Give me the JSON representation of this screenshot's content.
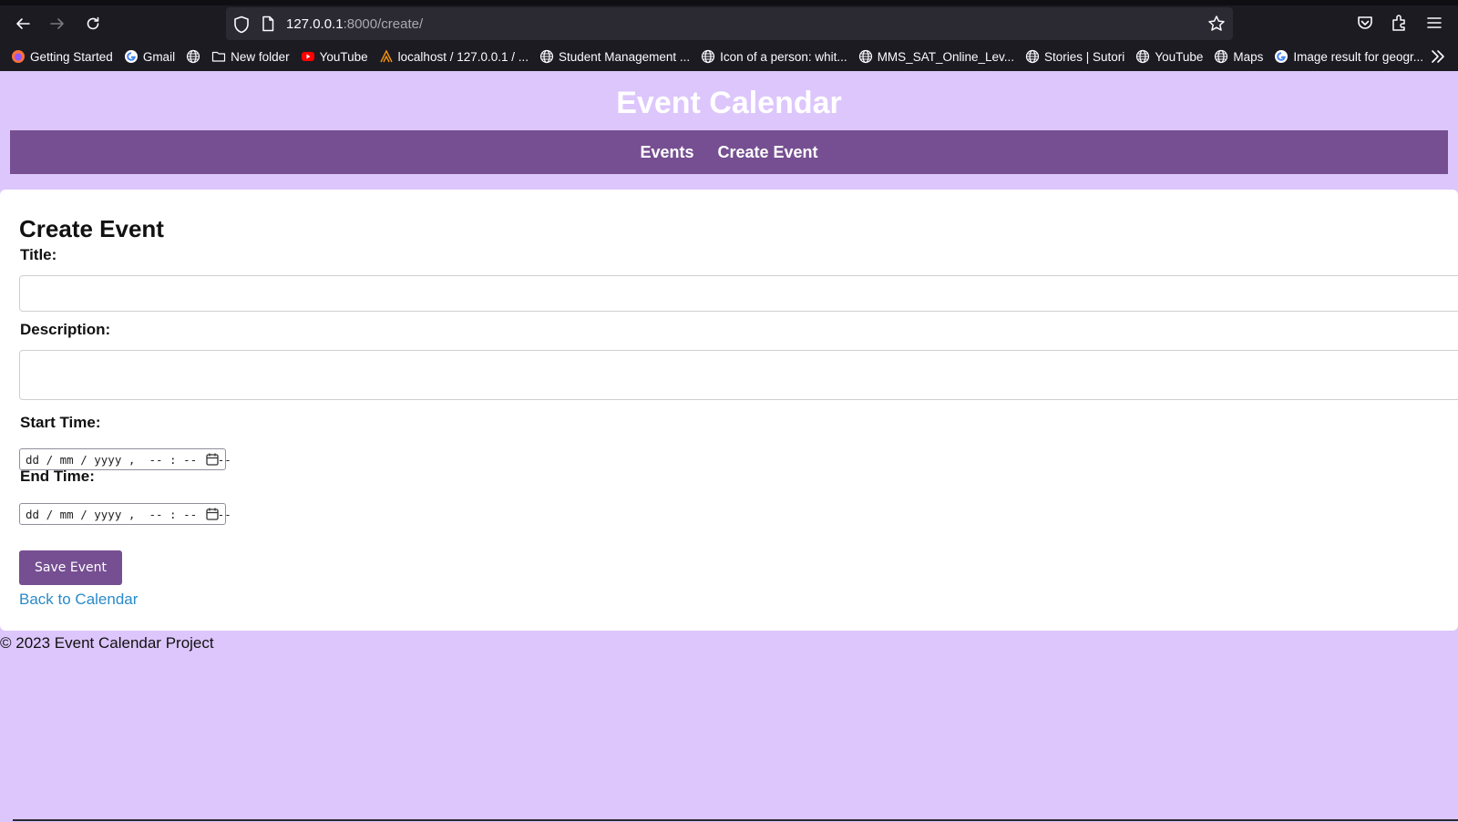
{
  "browser": {
    "url_host": "127.0.0.1",
    "url_path": ":8000/create/",
    "bookmarks": [
      {
        "label": "Getting Started",
        "icon": "firefox-icon"
      },
      {
        "label": "Gmail",
        "icon": "google-icon"
      },
      {
        "label": "",
        "icon": "globe-icon"
      },
      {
        "label": "New folder",
        "icon": "folder-icon"
      },
      {
        "label": "YouTube",
        "icon": "youtube-icon"
      },
      {
        "label": "localhost / 127.0.0.1 / ...",
        "icon": "phpmyadmin-icon"
      },
      {
        "label": "Student Management ...",
        "icon": "globe-icon"
      },
      {
        "label": "Icon of a person: whit...",
        "icon": "globe-icon"
      },
      {
        "label": "MMS_SAT_Online_Lev...",
        "icon": "globe-icon"
      },
      {
        "label": "Stories | Sutori",
        "icon": "globe-icon"
      },
      {
        "label": "YouTube",
        "icon": "globe-icon"
      },
      {
        "label": "Maps",
        "icon": "globe-icon"
      },
      {
        "label": "Image result for geogr...",
        "icon": "google-icon"
      }
    ]
  },
  "site": {
    "title": "Event Calendar",
    "nav": [
      "Events",
      "Create Event"
    ]
  },
  "form": {
    "heading": "Create Event",
    "title_label": "Title:",
    "title_value": "",
    "description_label": "Description:",
    "description_value": "",
    "start_label": "Start Time:",
    "start_placeholder": "dd / mm / yyyy ,  -- : --   --",
    "end_label": "End Time:",
    "end_placeholder": "dd / mm / yyyy ,  -- : --   --",
    "save_label": "Save Event",
    "back_label": "Back to Calendar"
  },
  "footer": {
    "text": "© 2023 Event Calendar Project"
  },
  "colors": {
    "page_bg": "#dcc6fb",
    "nav_bg": "#764f92",
    "button_bg": "#764f92",
    "link": "#2a8ac9",
    "chrome_bg": "#1c1b22"
  }
}
